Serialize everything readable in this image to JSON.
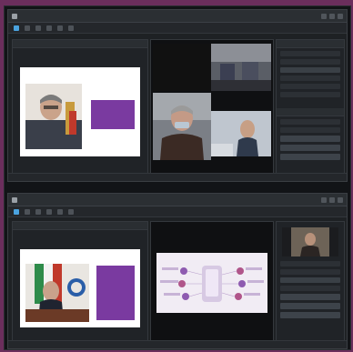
{
  "colors": {
    "background": "#6b2e5c",
    "window": "#1e2124",
    "accent": "#4aa3df",
    "slide_card": "#7a3aa0"
  },
  "windows": [
    {
      "toolbar_icons": [
        "select-icon",
        "grid-icon",
        "image-icon",
        "pen-icon",
        "crop-icon",
        "folder-icon"
      ],
      "slide": {
        "heading": "",
        "card_text": ""
      }
    },
    {
      "toolbar_icons": [
        "select-icon",
        "grid-icon",
        "image-icon",
        "pen-icon",
        "crop-icon",
        "folder-icon"
      ],
      "slide": {
        "heading": "",
        "card_text": ""
      },
      "center_slide": {
        "heading": ""
      }
    }
  ]
}
